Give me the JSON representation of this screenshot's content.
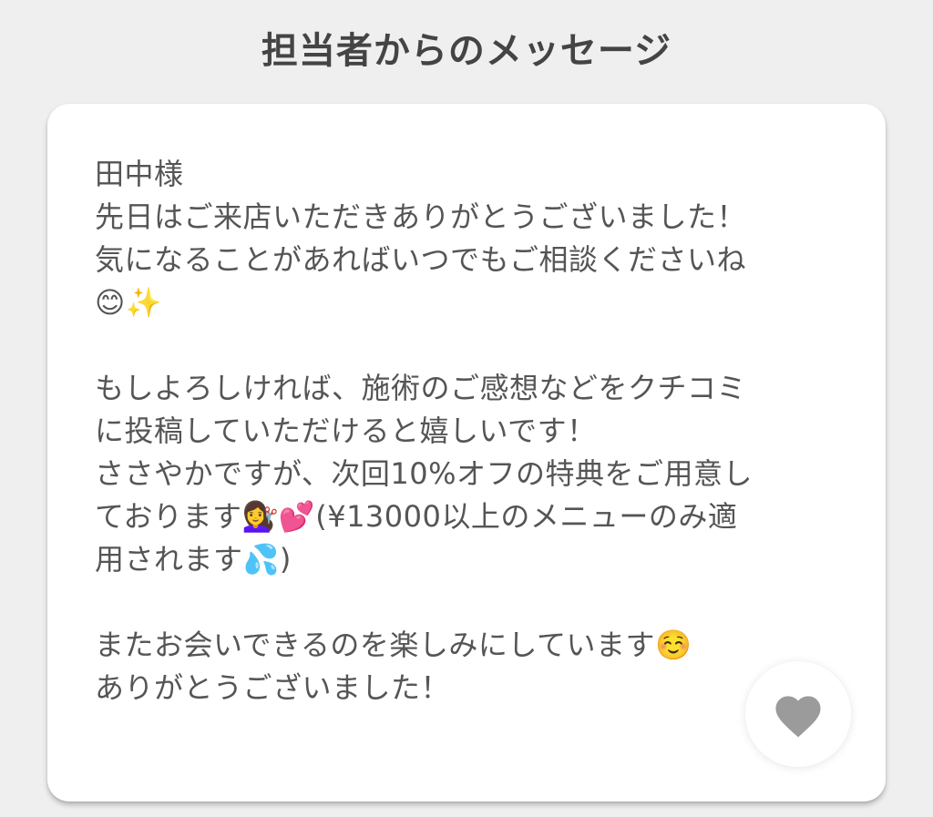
{
  "header": {
    "title": "担当者からのメッセージ"
  },
  "message": {
    "lines": [
      "田中様",
      "先日はご来店いただきありがとうございました！",
      "気になることがあればいつでもご相談くださいね",
      "😊✨",
      "",
      "もしよろしければ、施術のご感想などをクチコミ",
      "に投稿していただけると嬉しいです！",
      "ささやかですが、次回10%オフの特典をご用意し",
      "ております💇‍♀️💕(¥13000以上のメニューのみ適",
      "用されます💦)",
      "",
      "またお会いできるのを楽しみにしています☺️",
      "ありがとうございました！"
    ]
  },
  "like_button": {
    "icon": "heart-icon",
    "color": "#9b9b9b"
  },
  "colors": {
    "background": "#efefef",
    "card": "#ffffff",
    "title_text": "#444444",
    "body_text": "#555555"
  }
}
